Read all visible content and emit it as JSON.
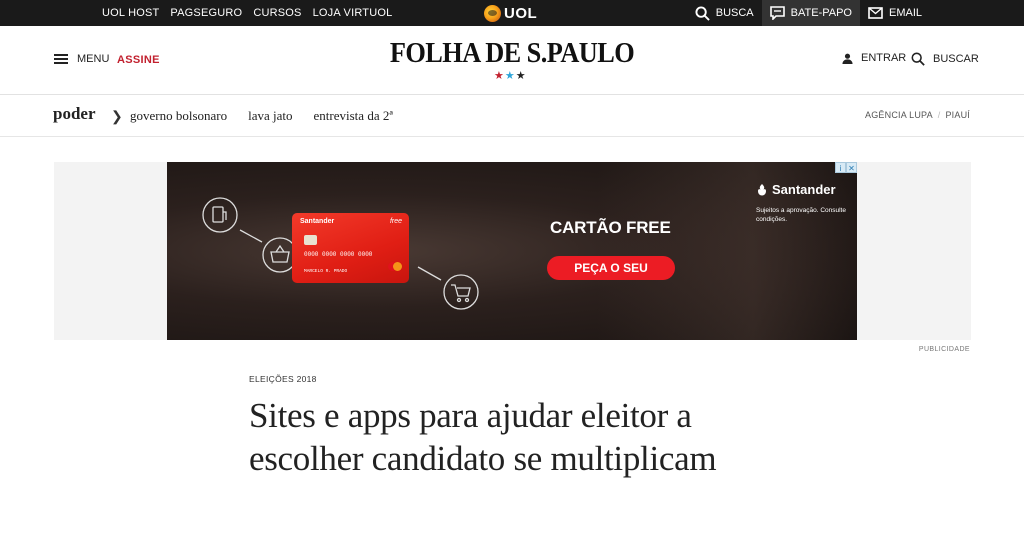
{
  "uol_bar": {
    "links": [
      "UOL HOST",
      "PAGSEGURO",
      "CURSOS",
      "LOJA VIRTUOL"
    ],
    "logo_text": "UOL",
    "right": {
      "search_label": "BUSCA",
      "chat_label": "BATE-PAPO",
      "email_label": "EMAIL"
    }
  },
  "header": {
    "menu_label": "MENU",
    "subscribe_label": "ASSINE",
    "logo_text": "FOLHA DE S.PAULO",
    "stars": [
      "★",
      "★",
      "★"
    ],
    "login_label": "ENTRAR",
    "search_label": "BUSCAR"
  },
  "section_nav": {
    "section": "poder",
    "links": [
      "governo bolsonaro",
      "lava jato",
      "entrevista da 2ª"
    ],
    "right_links": [
      "AGÊNCIA LUPA",
      "PIAUÍ"
    ]
  },
  "ad": {
    "card_brand": "Santander",
    "card_label": "free",
    "card_number": "0000 0000 0000 0000",
    "card_holder": "MARCELO R. PRADO",
    "title": "CARTÃO FREE",
    "cta": "PEÇA O SEU",
    "brand": "Santander",
    "note": "Sujeitos a aprovação. Consulte condições.",
    "label": "PUBLICIDADE"
  },
  "article": {
    "kicker": "ELEIÇÕES 2018",
    "headline": "Sites e apps para ajudar eleitor a escolher candidato se multiplicam"
  },
  "colors": {
    "uol_bar_bg": "#1a1a1a",
    "subscribe_red": "#c2212f",
    "star_blue": "#2ea5d9",
    "ad_red": "#ec1c24"
  }
}
